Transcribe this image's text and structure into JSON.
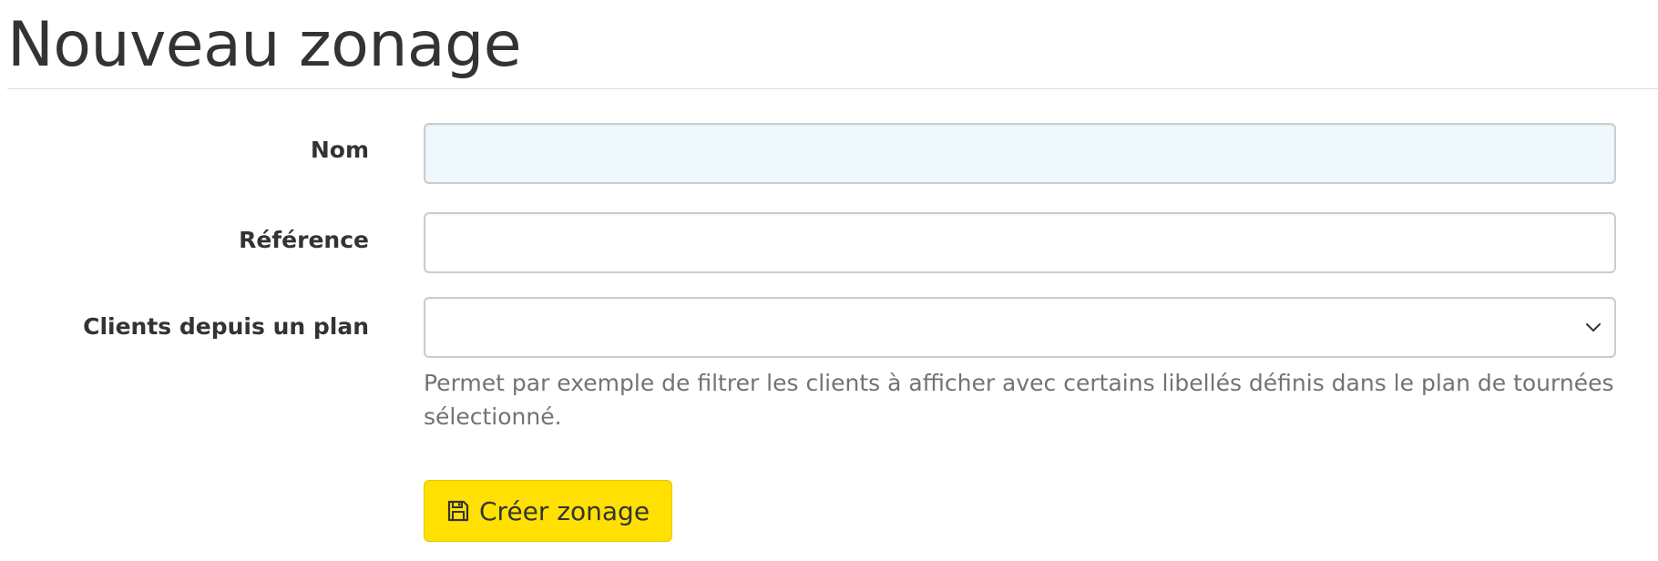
{
  "page": {
    "title": "Nouveau zonage"
  },
  "form": {
    "name": {
      "label": "Nom",
      "value": ""
    },
    "reference": {
      "label": "Référence",
      "value": ""
    },
    "plan_select": {
      "label": "Clients depuis un plan",
      "selected": "",
      "help": "Permet par exemple de filtrer les clients à afficher avec certains libellés définis dans le plan de tournées sélectionné."
    },
    "submit": {
      "label": "Créer zonage",
      "icon": "floppy-disk-icon",
      "color": "#ffe000"
    },
    "autofill_color": "#eef8fd"
  }
}
